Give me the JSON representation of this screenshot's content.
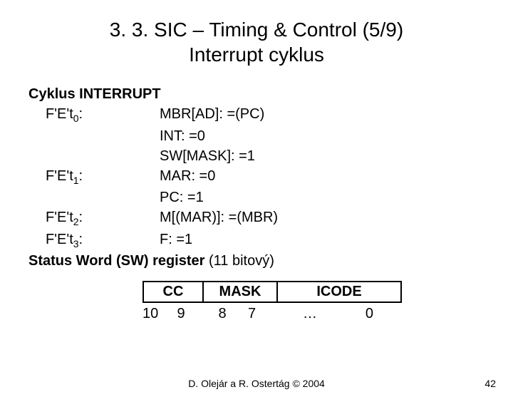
{
  "title_line1": "3. 3. SIC – Timing & Control (5/9)",
  "title_line2": "Interrupt cyklus",
  "section": "Cyklus INTERRUPT",
  "rows": [
    {
      "label_pre": "F'E't",
      "label_sub": "0",
      "label_post": ":",
      "rhs": "MBR[AD]: =(PC)"
    },
    {
      "label_pre": "",
      "label_sub": "",
      "label_post": "",
      "rhs": "INT: =0"
    },
    {
      "label_pre": "",
      "label_sub": "",
      "label_post": "",
      "rhs": "SW[MASK]: =1"
    },
    {
      "label_pre": "F'E't",
      "label_sub": "1",
      "label_post": ":",
      "rhs": "MAR: =0"
    },
    {
      "label_pre": "",
      "label_sub": "",
      "label_post": "",
      "rhs": "PC: =1"
    },
    {
      "label_pre": "F'E't",
      "label_sub": "2",
      "label_post": ":",
      "rhs": "M[(MAR)]: =(MBR)"
    },
    {
      "label_pre": "F'E't",
      "label_sub": "3",
      "label_post": ":",
      "rhs": "F: =1"
    }
  ],
  "sw_bold": "Status Word (SW) register ",
  "sw_norm": "(11 bitový)",
  "reg": {
    "cc": "CC",
    "mask": "MASK",
    "icode": "ICODE"
  },
  "bits": {
    "b10": "10",
    "b9": "9",
    "b8": "8",
    "b7": "7",
    "dots": "…",
    "b0": "0"
  },
  "footer": "D. Olejár a R. Ostertág © 2004",
  "page": "42"
}
